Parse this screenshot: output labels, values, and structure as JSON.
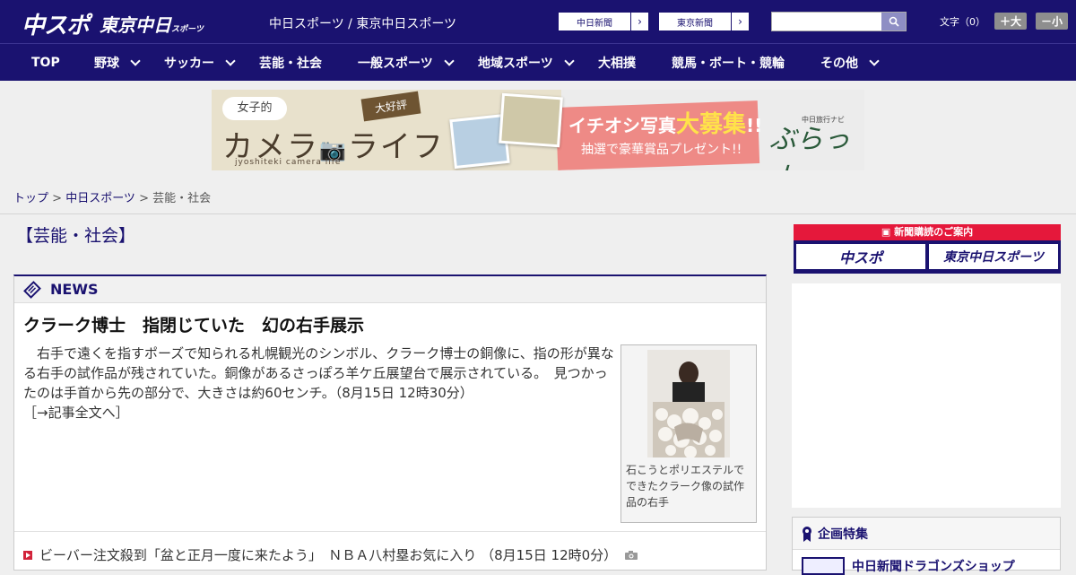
{
  "header": {
    "logo_chuspo": "中スポ",
    "logo_tokyo": "東京中日",
    "logo_tokyo_small": "スポーツ",
    "site_name": "中日スポーツ / 東京中日スポーツ",
    "paper_btn_1": "中日新聞",
    "paper_btn_2": "東京新聞",
    "search_placeholder": "",
    "font_size_label": "文字（0）",
    "font_bigger": "＋大",
    "font_smaller": "－小"
  },
  "nav": {
    "items": [
      {
        "label": "TOP",
        "dropdown": false
      },
      {
        "label": "野球",
        "dropdown": true
      },
      {
        "label": "サッカー",
        "dropdown": true
      },
      {
        "label": "芸能・社会",
        "dropdown": false
      },
      {
        "label": "一般スポーツ",
        "dropdown": true
      },
      {
        "label": "地域スポーツ",
        "dropdown": true
      },
      {
        "label": "大相撲",
        "dropdown": false
      },
      {
        "label": "競馬・ボート・競輪",
        "dropdown": false
      },
      {
        "label": "その他",
        "dropdown": true
      }
    ]
  },
  "banner": {
    "joshi": "女子的",
    "camera_life": "カメラ",
    "camera_life2": "ライフ",
    "sub": "jyoshiteki camera life",
    "tag": "大好評",
    "headline_pre": "イチオシ写真",
    "headline_big": "大募集",
    "headline_post": "!!",
    "subline": "抽選で豪華賞品プレゼント!!",
    "brand_small": "中日旅行ナビ",
    "brand": "ぶらっ人"
  },
  "breadcrumb": {
    "home": "トップ",
    "sep": " > ",
    "section": "中日スポーツ",
    "current": "芸能・社会"
  },
  "page": {
    "category_title": "【芸能・社会】"
  },
  "news": {
    "header": "NEWS",
    "top_article": {
      "title": "クラーク博士　指閉じていた　幻の右手展示",
      "body": "　右手で遠くを指すポーズで知られる札幌観光のシンボル、クラーク博士の銅像に、指の形が異なる右手の試作品が残されていた。銅像があるさっぽろ羊ケ丘展望台で展示されている。　見つかったのは手首から先の部分で、大きさは約60センチ。（8月15日 12時30分）",
      "more": "［→記事全文へ］",
      "photo_caption": "石こうとポリエステルでできたクラーク像の試作品の右手"
    },
    "items": [
      {
        "text": "ビーバー注文殺到「盆と正月一度に来たよう」　ＮＢＡ八村塁お気に入り （8月15日 12時0分）"
      }
    ]
  },
  "sidebar": {
    "subscription_title": "新聞購読のご案内",
    "sub_btn_1": "中スポ",
    "sub_btn_2": "東京中日スポーツ",
    "feature_title": "企画特集",
    "feature_item": "中日新聞ドラゴンズショップ"
  },
  "colors": {
    "brand_navy": "#1a1270",
    "accent_red": "#e5183b",
    "search_button": "#8e8ec4"
  }
}
